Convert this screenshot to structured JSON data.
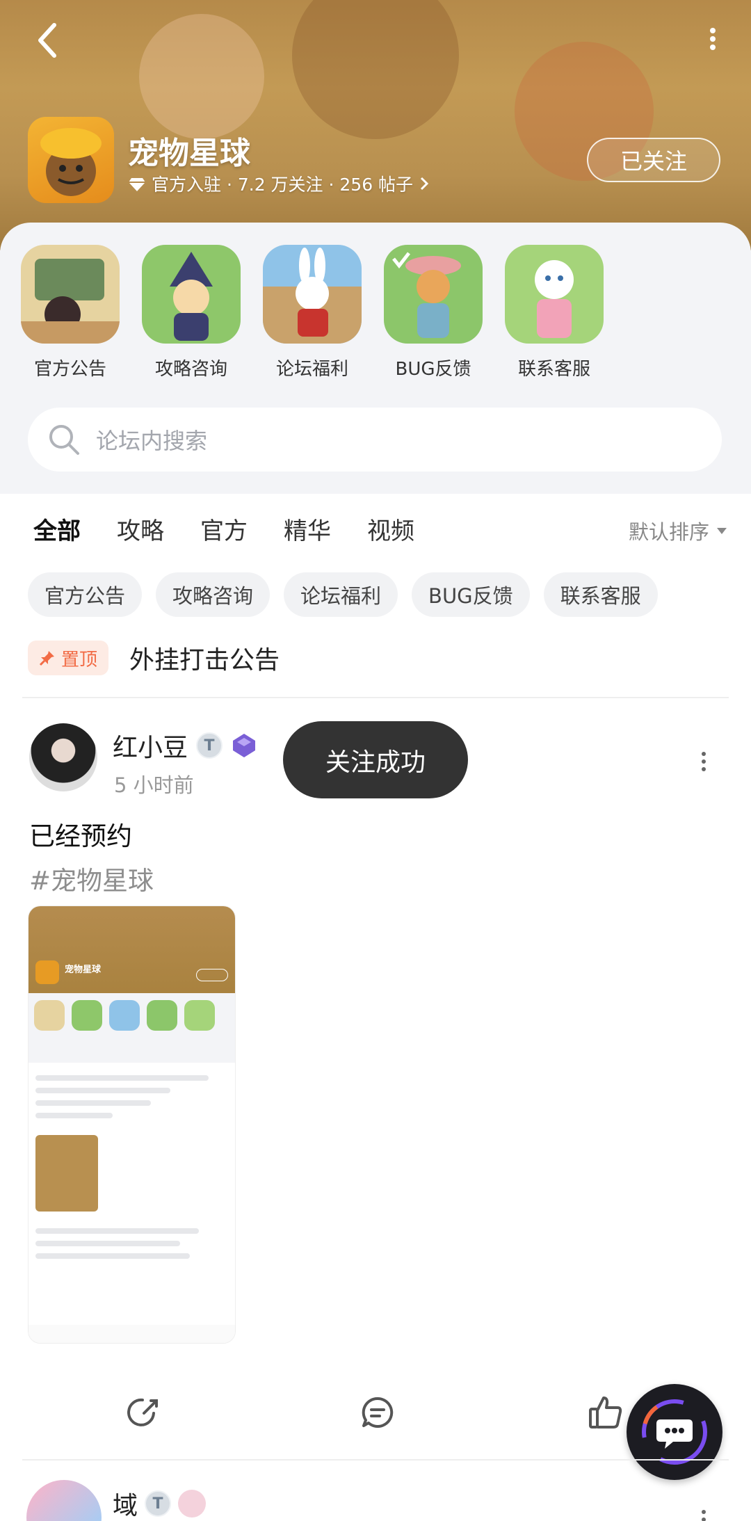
{
  "header": {
    "forum_name": "宠物星球",
    "meta": "官方入驻 · 7.2 万关注 · 256 帖子",
    "follow_label": "已关注"
  },
  "shortcuts": [
    {
      "label": "官方公告",
      "color": "#e6d3a0"
    },
    {
      "label": "攻略咨询",
      "color": "#8ec76a"
    },
    {
      "label": "论坛福利",
      "color": "#8fc3e8"
    },
    {
      "label": "BUG反馈",
      "color": "#8cc66a"
    },
    {
      "label": "联系客服",
      "color": "#a5d47a"
    }
  ],
  "search": {
    "placeholder": "论坛内搜索"
  },
  "tabs": [
    "全部",
    "攻略",
    "官方",
    "精华",
    "视频"
  ],
  "sort_label": "默认排序",
  "chips": [
    "官方公告",
    "攻略咨询",
    "论坛福利",
    "BUG反馈",
    "联系客服"
  ],
  "pinned": {
    "badge": "置顶",
    "title": "外挂打击公告"
  },
  "post": {
    "author": "红小豆",
    "level": "T",
    "time": "5 小时前",
    "text": "已经预约",
    "tag": "#宠物星球",
    "screenshot_title": "宠物星球"
  },
  "toast": "关注成功",
  "next_post": {
    "author": "域",
    "level": "T"
  },
  "colors": {
    "accent": "#2fd1c1",
    "pin": "#f26b45",
    "banner": "#b58a4a"
  }
}
